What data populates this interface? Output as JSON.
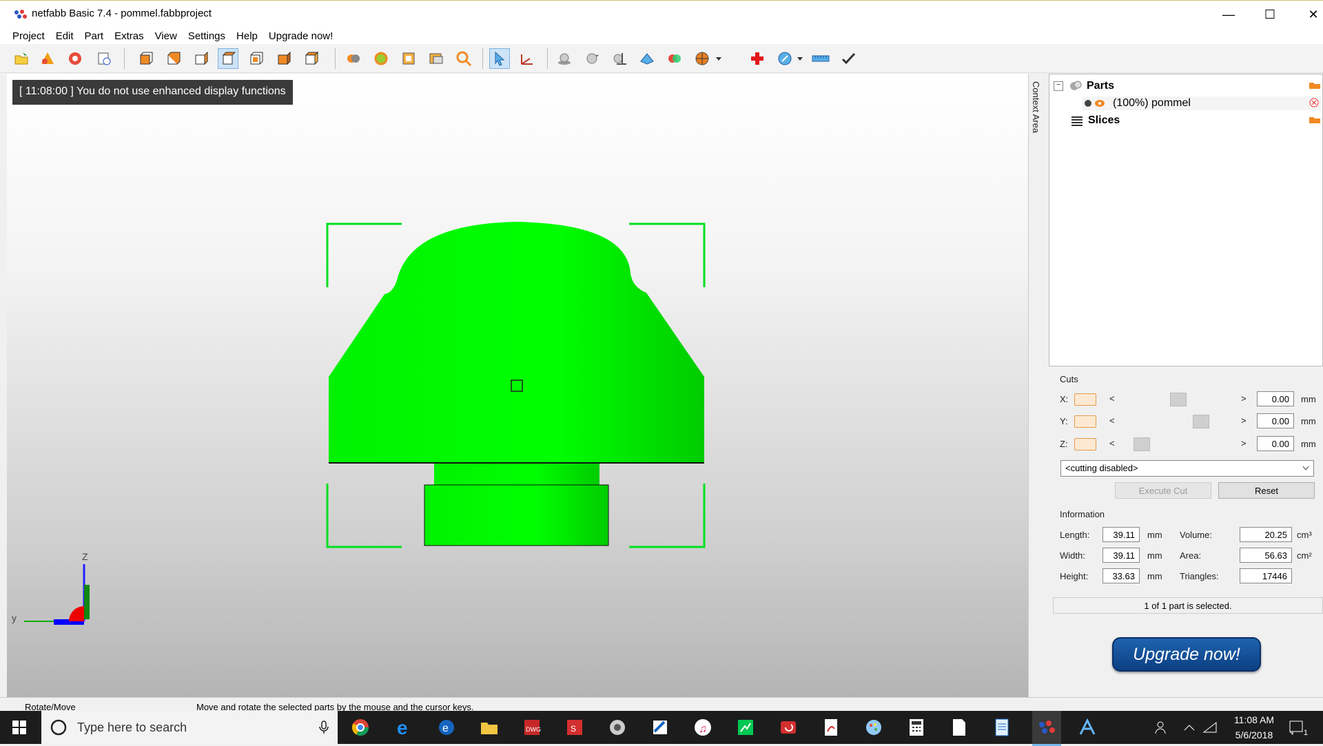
{
  "window": {
    "title": "netfabb Basic 7.4 - pommel.fabbproject",
    "minimize": "—",
    "maximize": "☐",
    "close": "✕"
  },
  "menu": [
    "Project",
    "Edit",
    "Part",
    "Extras",
    "View",
    "Settings",
    "Help",
    "Upgrade now!"
  ],
  "notice": "[ 11:08:00 ] You do not use enhanced display functions",
  "context_area": "Context Area",
  "tree": {
    "parts": "Parts",
    "part_item": "(100%) pommel",
    "slices": "Slices"
  },
  "cuts": {
    "title": "Cuts",
    "x_label": "X:",
    "y_label": "Y:",
    "z_label": "Z:",
    "x_value": "0.00",
    "y_value": "0.00",
    "z_value": "0.00",
    "unit": "mm",
    "lt": "<",
    "gt": ">",
    "mode": "<cutting disabled>",
    "execute": "Execute Cut",
    "reset": "Reset"
  },
  "info": {
    "title": "Information",
    "length_label": "Length:",
    "length": "39.11",
    "width_label": "Width:",
    "width": "39.11",
    "height_label": "Height:",
    "height": "33.63",
    "mm": "mm",
    "volume_label": "Volume:",
    "volume": "20.25",
    "area_label": "Area:",
    "area": "56.63",
    "triangles_label": "Triangles:",
    "triangles": "17446",
    "cm3": "cm³",
    "cm2": "cm²"
  },
  "selection_status": "1 of 1 part is selected.",
  "upgrade": "Upgrade now!",
  "status": {
    "mode": "Rotate/Move",
    "hint": "Move and rotate the selected parts by the mouse and the cursor keys."
  },
  "axes": {
    "z": "Z",
    "y": "y"
  },
  "taskbar": {
    "search_placeholder": "Type here to search",
    "time": "11:08 AM",
    "date": "5/6/2018",
    "notif_count": "1"
  },
  "colors": {
    "model": "#00ff00",
    "bracket": "#00e020",
    "accent": "#0c3f82"
  }
}
